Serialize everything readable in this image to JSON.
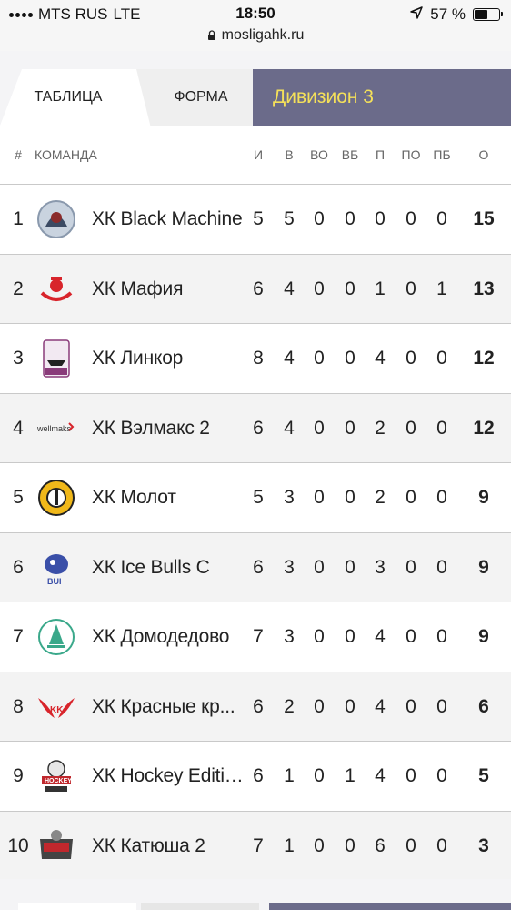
{
  "status_bar": {
    "carrier": "MTS RUS",
    "network": "LTE",
    "time": "18:50",
    "battery": "57 %",
    "battery_level": 0.57
  },
  "url": "mosligahk.ru",
  "tabs": {
    "table": "ТАБЛИЦА",
    "form": "ФОРМА",
    "division": "Дивизион 3"
  },
  "columns": {
    "rank": "#",
    "team": "КОМАНДА",
    "games": "И",
    "wins": "В",
    "ot_wins": "ВО",
    "so_wins": "ВБ",
    "losses": "П",
    "ot_losses": "ПО",
    "so_losses": "ПБ",
    "points": "О"
  },
  "rows": [
    {
      "rank": "1",
      "team": "ХК Black Machine",
      "i": "5",
      "v": "5",
      "vo": "0",
      "vb": "0",
      "p": "0",
      "po": "0",
      "pb": "0",
      "o": "15",
      "logo": "black-machine-logo"
    },
    {
      "rank": "2",
      "team": "ХК Мафия",
      "i": "6",
      "v": "4",
      "vo": "0",
      "vb": "0",
      "p": "1",
      "po": "0",
      "pb": "1",
      "o": "13",
      "logo": "mafia-logo"
    },
    {
      "rank": "3",
      "team": "ХК Линкор",
      "i": "8",
      "v": "4",
      "vo": "0",
      "vb": "0",
      "p": "4",
      "po": "0",
      "pb": "0",
      "o": "12",
      "logo": "linkor-logo"
    },
    {
      "rank": "4",
      "team": "ХК Вэлмакс 2",
      "i": "6",
      "v": "4",
      "vo": "0",
      "vb": "0",
      "p": "2",
      "po": "0",
      "pb": "0",
      "o": "12",
      "logo": "wellmaks-logo"
    },
    {
      "rank": "5",
      "team": "ХК Молот",
      "i": "5",
      "v": "3",
      "vo": "0",
      "vb": "0",
      "p": "2",
      "po": "0",
      "pb": "0",
      "o": "9",
      "logo": "molot-logo"
    },
    {
      "rank": "6",
      "team": "ХК Ice Bulls C",
      "i": "6",
      "v": "3",
      "vo": "0",
      "vb": "0",
      "p": "3",
      "po": "0",
      "pb": "0",
      "o": "9",
      "logo": "ice-bulls-logo"
    },
    {
      "rank": "7",
      "team": "ХК Домодедово",
      "i": "7",
      "v": "3",
      "vo": "0",
      "vb": "0",
      "p": "4",
      "po": "0",
      "pb": "0",
      "o": "9",
      "logo": "domodedovo-logo"
    },
    {
      "rank": "8",
      "team": "ХК Красные кр...",
      "i": "6",
      "v": "2",
      "vo": "0",
      "vb": "0",
      "p": "4",
      "po": "0",
      "pb": "0",
      "o": "6",
      "logo": "krasnye-krylya-logo"
    },
    {
      "rank": "9",
      "team": "ХК Hockey Edition",
      "i": "6",
      "v": "1",
      "vo": "0",
      "vb": "1",
      "p": "4",
      "po": "0",
      "pb": "0",
      "o": "5",
      "logo": "hockey-edition-logo"
    },
    {
      "rank": "10",
      "team": "ХК Катюша 2",
      "i": "7",
      "v": "1",
      "vo": "0",
      "vb": "0",
      "p": "6",
      "po": "0",
      "pb": "0",
      "o": "3",
      "logo": "katyusha-logo"
    }
  ],
  "colors": {
    "division_bg": "#6b6b8a",
    "division_text": "#f4e05a",
    "row_alt": "#f3f3f3",
    "divider": "#c9c9c9"
  }
}
